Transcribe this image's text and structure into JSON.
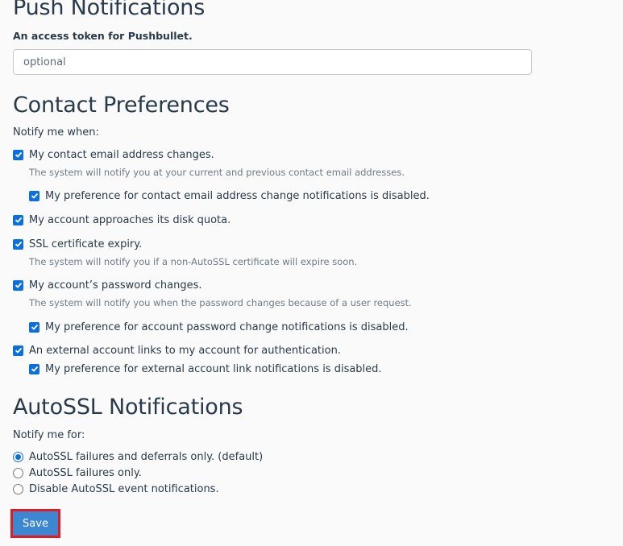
{
  "push_notifications": {
    "title": "Push Notifications",
    "token_label": "An access token for Pushbullet.",
    "token_value": "",
    "token_placeholder": "optional"
  },
  "contact_preferences": {
    "title": "Contact Preferences",
    "notify_label": "Notify me when:",
    "items": [
      {
        "label": "My contact email address changes.",
        "checked": true,
        "level": 0
      },
      {
        "help": "The system will notify you at your current and previous contact email addresses."
      },
      {
        "label": "My preference for contact email address change notifications is disabled.",
        "checked": true,
        "level": 1
      },
      {
        "label": "My account approaches its disk quota.",
        "checked": true,
        "level": 0
      },
      {
        "label": "SSL certificate expiry.",
        "checked": true,
        "level": 0
      },
      {
        "help": "The system will notify you if a non-AutoSSL certificate will expire soon."
      },
      {
        "label": "My account’s password changes.",
        "checked": true,
        "level": 0
      },
      {
        "help": "The system will notify you when the password changes because of a user request."
      },
      {
        "label": "My preference for account password change notifications is disabled.",
        "checked": true,
        "level": 1
      },
      {
        "label": "An external account links to my account for authentication.",
        "checked": true,
        "level": 0
      },
      {
        "label": "My preference for external account link notifications is disabled.",
        "checked": true,
        "level": 1
      }
    ]
  },
  "autossl_notifications": {
    "title": "AutoSSL Notifications",
    "notify_label": "Notify me for:",
    "options": [
      {
        "label": "AutoSSL failures and deferrals only. (default)",
        "selected": true
      },
      {
        "label": "AutoSSL failures only.",
        "selected": false
      },
      {
        "label": "Disable AutoSSL event notifications.",
        "selected": false
      }
    ]
  },
  "actions": {
    "save_label": "Save"
  },
  "colors": {
    "accent": "#0b6fe0",
    "button": "#3b87d1",
    "highlight_border": "#e31b23",
    "heading": "#293a4a",
    "help_text": "#6f7b86"
  }
}
